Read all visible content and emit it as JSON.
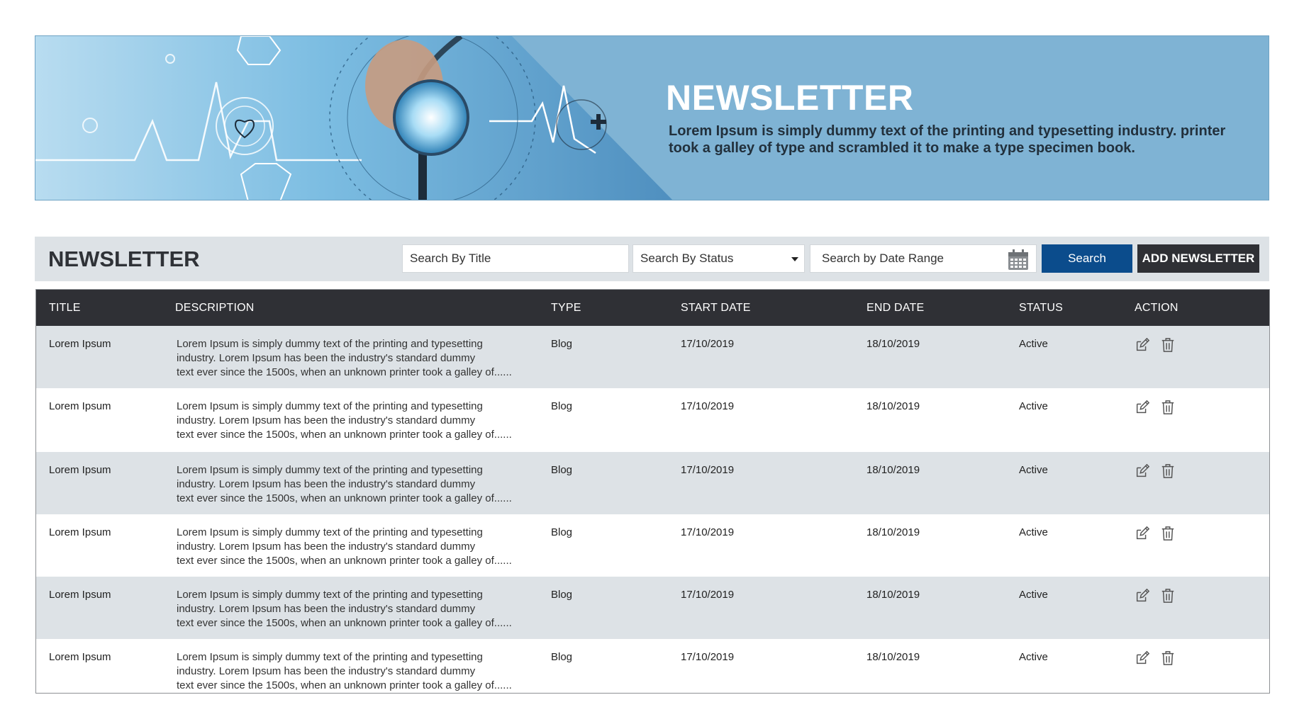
{
  "banner": {
    "title": "NEWSLETTER",
    "text": "Lorem Ipsum is simply dummy text of the printing and typesetting industry. printer took a galley of type and scrambled it to make a type specimen book."
  },
  "toolbar": {
    "title": "NEWSLETTER",
    "search_title_placeholder": "Search By Title",
    "search_status_value": "Search By Status",
    "search_date_placeholder": "Search by Date Range",
    "search_label": "Search",
    "add_label": "ADD NEWSLETTER"
  },
  "table": {
    "columns": [
      "TITLE",
      "DESCRIPTION",
      "TYPE",
      "START DATE",
      "END DATE",
      "STATUS",
      "ACTION"
    ],
    "rows": [
      {
        "title": "Lorem Ipsum",
        "desc1": "Lorem Ipsum is simply dummy text of the printing and typesetting",
        "desc2": "industry. Lorem Ipsum has been the industry's standard dummy",
        "desc3": "text ever since the 1500s, when an unknown printer took a galley of......",
        "type": "Blog",
        "start": "17/10/2019",
        "end": "18/10/2019",
        "status": "Active"
      },
      {
        "title": "Lorem Ipsum",
        "desc1": "Lorem Ipsum is simply dummy text of the printing and typesetting",
        "desc2": "industry. Lorem Ipsum has been the industry's standard dummy",
        "desc3": "text ever since the 1500s, when an unknown printer took a galley of......",
        "type": "Blog",
        "start": "17/10/2019",
        "end": "18/10/2019",
        "status": "Active"
      },
      {
        "title": "Lorem Ipsum",
        "desc1": "Lorem Ipsum is simply dummy text of the printing and typesetting",
        "desc2": "industry. Lorem Ipsum has been the industry's standard dummy",
        "desc3": "text ever since the 1500s, when an unknown printer took a galley of......",
        "type": "Blog",
        "start": "17/10/2019",
        "end": "18/10/2019",
        "status": "Active"
      },
      {
        "title": "Lorem Ipsum",
        "desc1": "Lorem Ipsum is simply dummy text of the printing and typesetting",
        "desc2": "industry. Lorem Ipsum has been the industry's standard dummy",
        "desc3": "text ever since the 1500s, when an unknown printer took a galley of......",
        "type": "Blog",
        "start": "17/10/2019",
        "end": "18/10/2019",
        "status": "Active"
      },
      {
        "title": "Lorem Ipsum",
        "desc1": "Lorem Ipsum is simply dummy text of the printing and typesetting",
        "desc2": "industry. Lorem Ipsum has been the industry's standard dummy",
        "desc3": "text ever since the 1500s, when an unknown printer took a galley of......",
        "type": "Blog",
        "start": "17/10/2019",
        "end": "18/10/2019",
        "status": "Active"
      },
      {
        "title": "Lorem Ipsum",
        "desc1": "Lorem Ipsum is simply dummy text of the printing and typesetting",
        "desc2": "industry. Lorem Ipsum has been the industry's standard dummy",
        "desc3": "text ever since the 1500s, when an unknown printer took a galley of......",
        "type": "Blog",
        "start": "17/10/2019",
        "end": "18/10/2019",
        "status": "Active"
      }
    ],
    "row_actions": [
      "edit-icon",
      "trash-icon"
    ]
  },
  "colors": {
    "banner_bg": "#7fb3d4",
    "toolbar_bg": "#dde2e6",
    "header_bg": "#2f3035",
    "search_button": "#0b4c8c",
    "add_button": "#2f3035"
  }
}
